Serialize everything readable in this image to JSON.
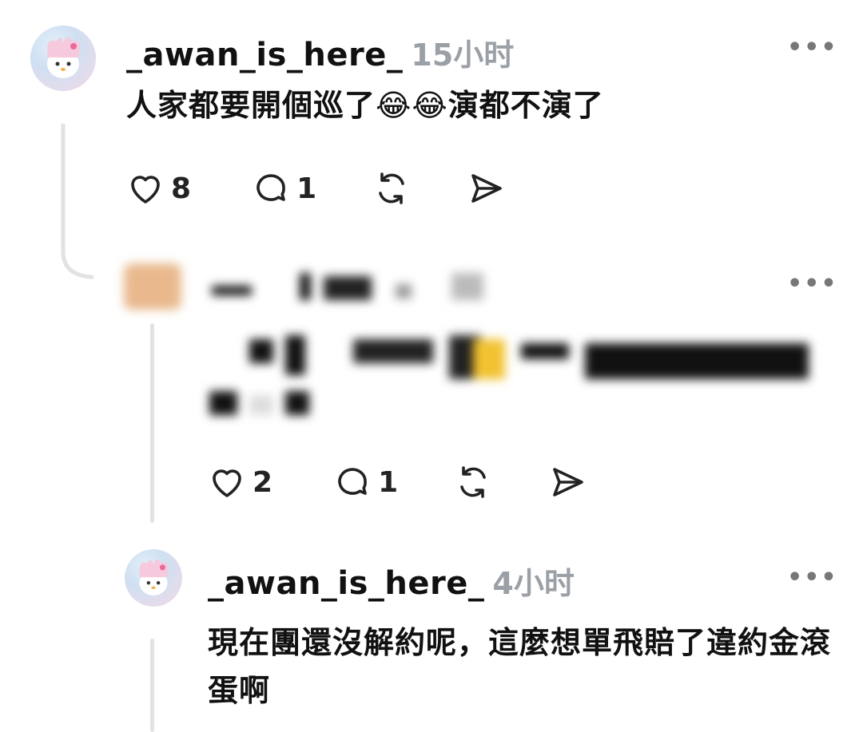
{
  "posts": [
    {
      "username": "_awan_is_here_",
      "time": "15小时",
      "text": "人家都要開個巡了😂😂演都不演了",
      "likes": "8",
      "comments": "1",
      "more": "•••"
    },
    {
      "likes": "2",
      "comments": "1",
      "more": "•••"
    },
    {
      "username": "_awan_is_here_",
      "time": "4小时",
      "text": "現在團還沒解約呢，這麼想單飛賠了違約金滾蛋啊",
      "more": "•••"
    }
  ],
  "icons": {
    "like": "heart-icon",
    "comment": "comment-icon",
    "repost": "repost-icon",
    "share": "share-icon"
  },
  "colors": {
    "text": "#111111",
    "muted": "#9aa0a6",
    "thread_line": "#e2e2e2",
    "avatar_pink": "#f5d8e6",
    "avatar_blue": "#cfe0f2"
  }
}
